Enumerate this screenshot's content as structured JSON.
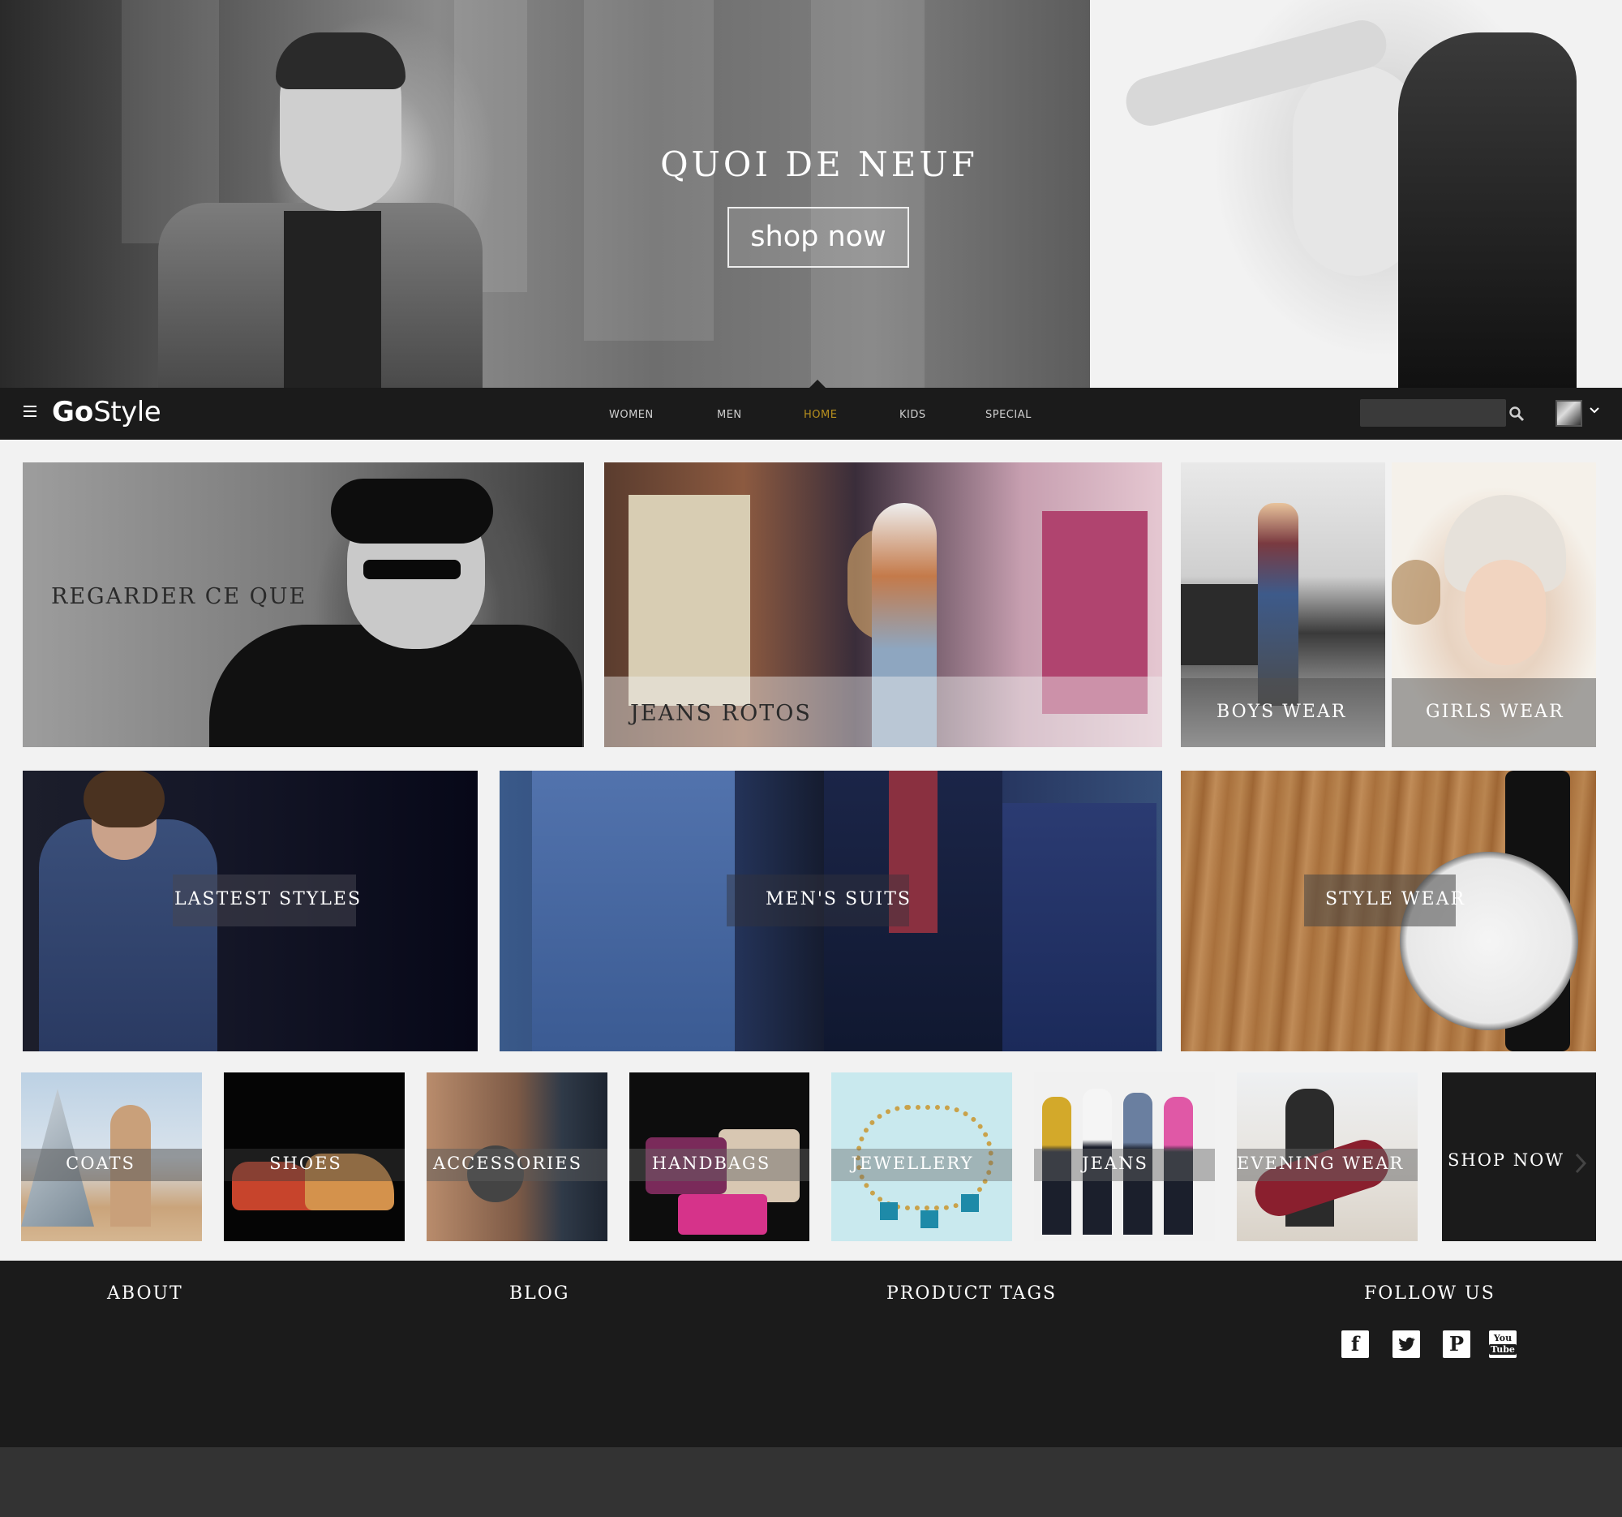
{
  "hero": {
    "title": "QUOI DE NEUF",
    "button": "shop now"
  },
  "nav": {
    "logo_bold": "Go",
    "logo_light": "Style",
    "links": [
      "WOMEN",
      "MEN",
      "HOME",
      "KIDS",
      "SPECIAL"
    ],
    "active": "HOME",
    "search_placeholder": "",
    "accent_color": "#b8901e"
  },
  "features": {
    "regarder": "REGARDER CE QUE",
    "jeans_rotos": "JEANS ROTOS",
    "boys_wear": "BOYS WEAR",
    "girls_wear": "GIRLS WEAR",
    "latest_styles": "LASTEST STYLES",
    "mens_suits": "MEN'S SUITS",
    "style_wear": "STYLE WEAR"
  },
  "categories": [
    "COATS",
    "SHOES",
    "ACCESSORIES",
    "HANDBAGS",
    "JEWELLERY",
    "JEANS",
    "EVENING WEAR"
  ],
  "shop_now_tile": "SHOP NOW",
  "footer": {
    "about": "ABOUT",
    "blog": "BLOG",
    "product_tags": "PRODUCT TAGS",
    "follow_us": "FOLLOW US",
    "social_icons": [
      "facebook-icon",
      "twitter-icon",
      "pinterest-icon",
      "youtube-icon"
    ]
  }
}
